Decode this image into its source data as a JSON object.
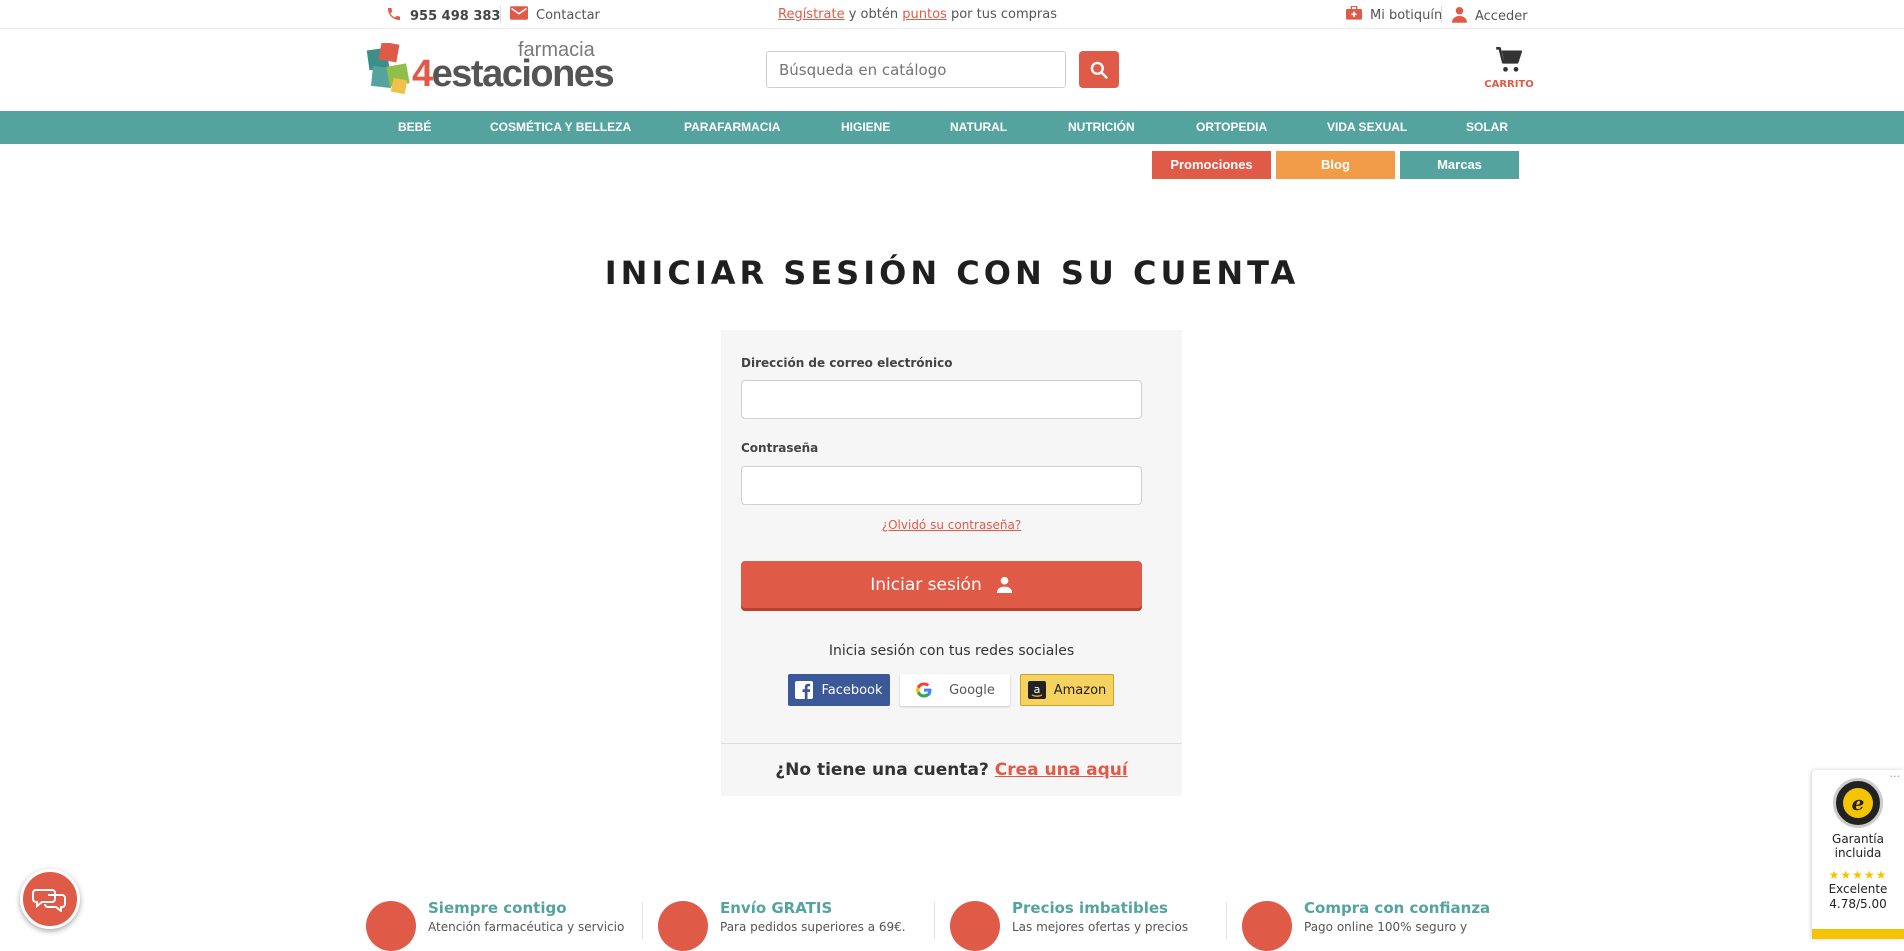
{
  "topbar": {
    "phone": "955 498 383",
    "contact": "Contactar",
    "register": "Regístrate",
    "promo_mid": "y obtén",
    "points": "puntos",
    "promo_end": "por tus compras",
    "botiquin": "Mi botiquín",
    "acceder": "Acceder"
  },
  "header": {
    "logo_small": "farmacia",
    "logo_number": "4",
    "logo_word": "estaciones",
    "search_placeholder": "Búsqueda en catálogo",
    "cart_label": "CARRITO"
  },
  "nav": {
    "items": [
      "BEBÉ",
      "COSMÉTICA Y BELLEZA",
      "PARAFARMACIA",
      "HIGIENE",
      "NATURAL",
      "NUTRICIÓN",
      "ORTOPEDIA",
      "VIDA SEXUAL",
      "SOLAR"
    ]
  },
  "tags": {
    "promociones": "Promociones",
    "blog": "Blog",
    "marcas": "Marcas"
  },
  "colors": {
    "accent": "#e05a48",
    "teal": "#55a39f",
    "orange": "#f29c4a"
  },
  "login": {
    "title": "INICIAR SESIÓN CON SU CUENTA",
    "email_label": "Dirección de correo electrónico",
    "email_value": "",
    "password_label": "Contraseña",
    "password_value": "",
    "forgot": "¿Olvidó su contraseña?",
    "submit": "Iniciar sesión",
    "social_text": "Inicia sesión con tus redes sociales",
    "facebook": "Facebook",
    "google": "Google",
    "amazon": "Amazon",
    "no_account": "¿No tiene una cuenta?",
    "create": "Crea una aquí"
  },
  "features": [
    {
      "title": "Siempre contigo",
      "sub": "Atención farmacéutica y servicio"
    },
    {
      "title": "Envío GRATIS",
      "sub": "Para pedidos superiores a 69€."
    },
    {
      "title": "Precios imbatibles",
      "sub": "Las mejores ofertas y precios"
    },
    {
      "title": "Compra con confianza",
      "sub": "Pago online 100% seguro y"
    }
  ],
  "trusted": {
    "dots": "···",
    "guarantee": "Garantía incluida",
    "stars": "★★★★★",
    "label": "Excelente",
    "score": "4.78/5.00"
  }
}
